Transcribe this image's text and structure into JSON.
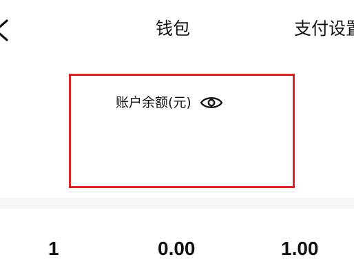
{
  "header": {
    "title": "钱包",
    "settings_label": "支付设置"
  },
  "balance": {
    "label": "账户余额(元)"
  },
  "stats": [
    {
      "value": "1"
    },
    {
      "value": "0.00"
    },
    {
      "value": "1.00"
    }
  ],
  "colors": {
    "card_border": "#d62424",
    "divider_band": "#f5f5f7",
    "text": "#111111"
  },
  "icons": {
    "back": "chevron-left-icon",
    "visibility": "eye-icon"
  }
}
